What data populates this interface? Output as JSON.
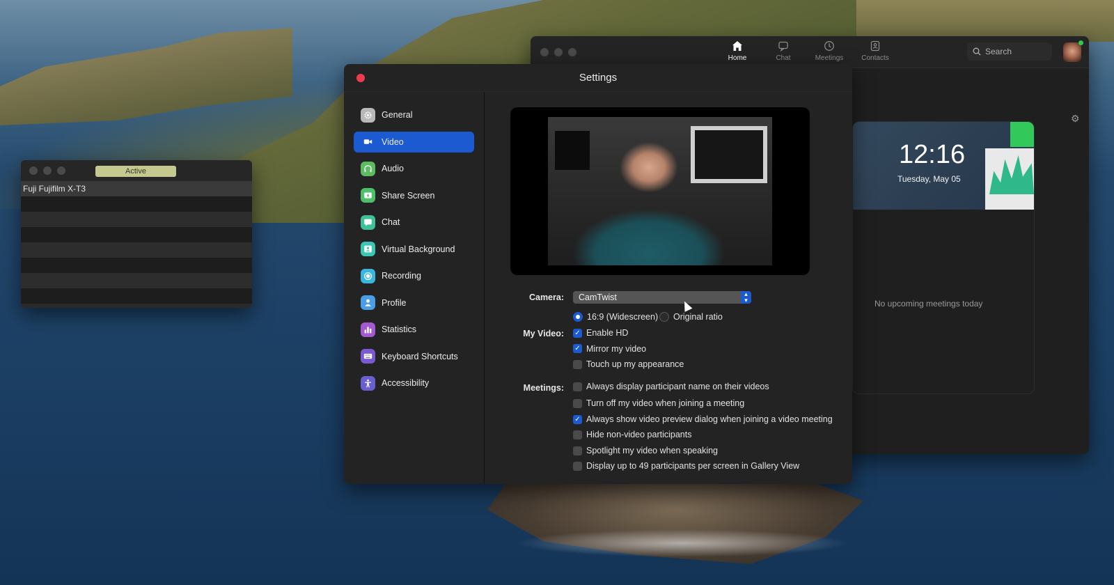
{
  "camtwist_window": {
    "status_badge": "Active",
    "sources": [
      "Fuji Fujifilm X-T3",
      "",
      "",
      "",
      "",
      "",
      "",
      ""
    ]
  },
  "zoom_main": {
    "tabs": [
      {
        "label": "Home",
        "icon": "home-icon",
        "active": true
      },
      {
        "label": "Chat",
        "icon": "chat-bubble-icon",
        "active": false
      },
      {
        "label": "Meetings",
        "icon": "clock-icon",
        "active": false
      },
      {
        "label": "Contacts",
        "icon": "contact-card-icon",
        "active": false
      }
    ],
    "search_placeholder": "Search",
    "clock": {
      "time": "12:16",
      "date": "Tuesday, May 05"
    },
    "no_meetings_text": "No upcoming meetings today",
    "status_color": "#2ecc4a"
  },
  "settings": {
    "title": "Settings",
    "nav": [
      {
        "label": "General",
        "icon": "gear-icon",
        "color": "#b8b8b8",
        "active": false
      },
      {
        "label": "Video",
        "icon": "video-camera-icon",
        "color": "#1c5ad1",
        "active": true
      },
      {
        "label": "Audio",
        "icon": "headphones-icon",
        "color": "#5dbb63",
        "active": false
      },
      {
        "label": "Share Screen",
        "icon": "share-screen-icon",
        "color": "#4cc06a",
        "active": false
      },
      {
        "label": "Chat",
        "icon": "chat-bubble-icon",
        "color": "#3fbf9a",
        "active": false
      },
      {
        "label": "Virtual Background",
        "icon": "virtual-background-icon",
        "color": "#3cc7b5",
        "active": false
      },
      {
        "label": "Recording",
        "icon": "recording-icon",
        "color": "#38b6e0",
        "active": false
      },
      {
        "label": "Profile",
        "icon": "profile-icon",
        "color": "#4a9ee6",
        "active": false
      },
      {
        "label": "Statistics",
        "icon": "statistics-icon",
        "color": "#a35ad1",
        "active": false
      },
      {
        "label": "Keyboard Shortcuts",
        "icon": "keyboard-icon",
        "color": "#7a5ad1",
        "active": false
      },
      {
        "label": "Accessibility",
        "icon": "accessibility-icon",
        "color": "#6a5fd1",
        "active": false
      }
    ],
    "video": {
      "camera_label": "Camera:",
      "camera_value": "CamTwist",
      "ratio_options": [
        {
          "label": "16:9 (Widescreen)",
          "selected": true
        },
        {
          "label": "Original ratio",
          "selected": false
        }
      ],
      "my_video_label": "My Video:",
      "my_video_options": [
        {
          "label": "Enable HD",
          "checked": true
        },
        {
          "label": "Mirror my video",
          "checked": true
        },
        {
          "label": "Touch up my appearance",
          "checked": false
        }
      ],
      "meetings_label": "Meetings:",
      "meetings_options": [
        {
          "label": "Always display participant name on their videos",
          "checked": false
        },
        {
          "label": "Turn off my video when joining a meeting",
          "checked": false
        },
        {
          "label": "Always show video preview dialog when joining a video meeting",
          "checked": true
        },
        {
          "label": "Hide non-video participants",
          "checked": false
        },
        {
          "label": "Spotlight my video when speaking",
          "checked": false
        },
        {
          "label": "Display up to 49 participants per screen in Gallery View",
          "checked": false
        }
      ]
    },
    "accent_color": "#1c5ad1"
  }
}
